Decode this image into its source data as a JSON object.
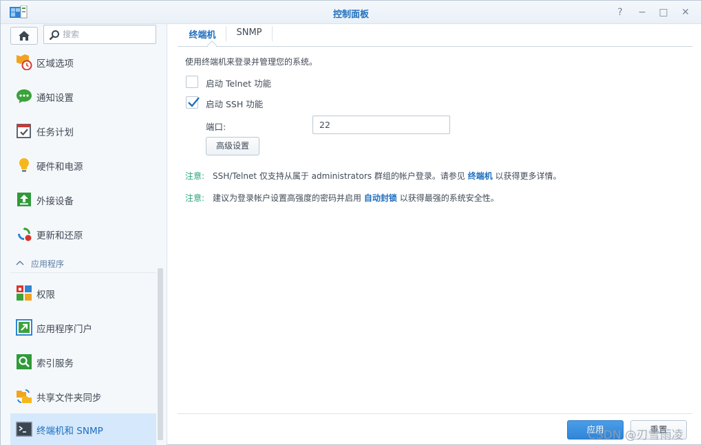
{
  "window": {
    "title": "控制面板",
    "controls": {
      "help": "?",
      "minimize": "−",
      "maximize": "□",
      "close": "✕"
    }
  },
  "sidebar": {
    "search_placeholder": "搜索",
    "items": [
      {
        "label": "区域选项",
        "icon": "calendar-clock-icon"
      },
      {
        "label": "通知设置",
        "icon": "chat-bubble-icon"
      },
      {
        "label": "任务计划",
        "icon": "task-calendar-icon"
      },
      {
        "label": "硬件和电源",
        "icon": "lightbulb-icon"
      },
      {
        "label": "外接设备",
        "icon": "upload-device-icon"
      },
      {
        "label": "更新和还原",
        "icon": "refresh-icon"
      }
    ],
    "section": "应用程序",
    "app_items": [
      {
        "label": "权限",
        "icon": "lock-grid-icon"
      },
      {
        "label": "应用程序门户",
        "icon": "portal-arrow-icon"
      },
      {
        "label": "索引服务",
        "icon": "search-index-icon"
      },
      {
        "label": "共享文件夹同步",
        "icon": "folder-sync-icon"
      },
      {
        "label": "终端机和 SNMP",
        "icon": "terminal-icon",
        "active": true
      }
    ]
  },
  "tabs": [
    {
      "label": "终端机",
      "active": true
    },
    {
      "label": "SNMP",
      "active": false
    }
  ],
  "content": {
    "description": "使用终端机来登录并管理您的系统。",
    "telnet": {
      "label": "启动 Telnet 功能",
      "checked": false
    },
    "ssh": {
      "label": "启动 SSH 功能",
      "checked": true
    },
    "port_label": "端口:",
    "port_value": "22",
    "advanced_button": "高级设置",
    "note1": {
      "tag": "注意:",
      "text_before": "SSH/Telnet 仅支持从属于 administrators 群组的帐户登录。请参见 ",
      "link": "终端机",
      "text_after": " 以获得更多详情。"
    },
    "note2": {
      "tag": "注意:",
      "text_before": "建议为登录帐户设置高强度的密码并启用 ",
      "link": "自动封锁",
      "text_after": " 以获得最强的系统安全性。"
    }
  },
  "footer": {
    "apply": "应用",
    "reset": "重置"
  },
  "watermark": "CSDN @刃雪雨凌",
  "colors": {
    "accent": "#1e6fbf",
    "note": "#2aa37a",
    "active_bg": "#d6e8fb"
  }
}
